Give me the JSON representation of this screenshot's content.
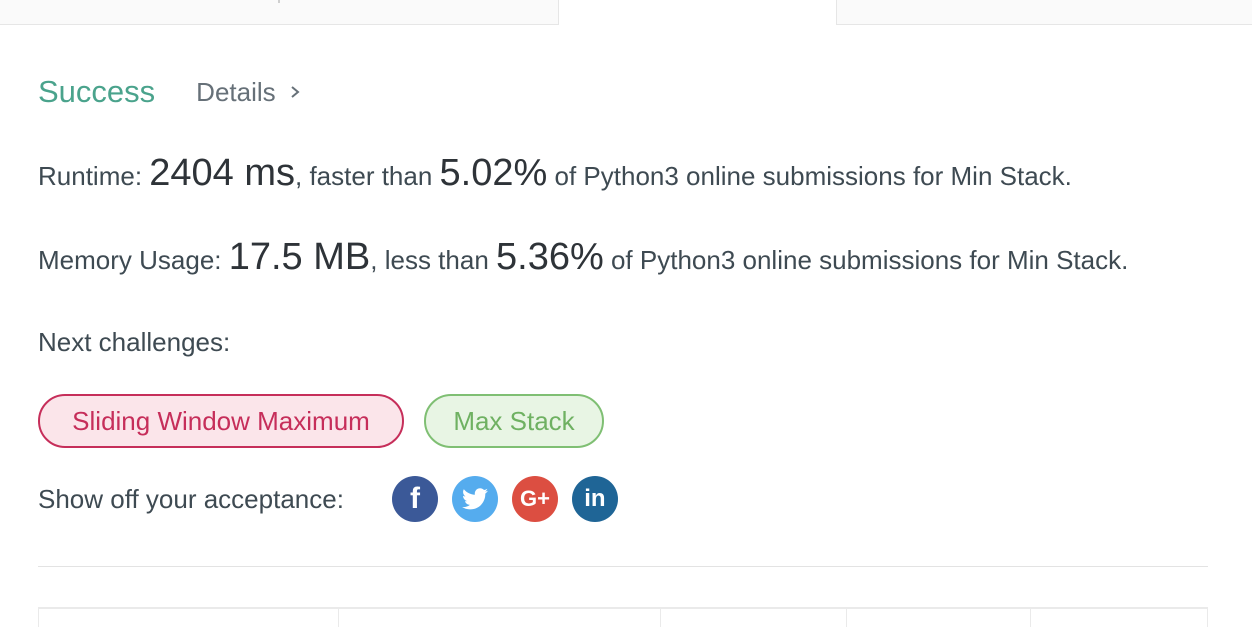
{
  "result": {
    "status": "Success",
    "details_link": "Details",
    "status_color": "#4aa38c"
  },
  "runtime": {
    "label": "Runtime: ",
    "value": "2404 ms",
    "comparison": ", faster than ",
    "percent": "5.02%",
    "suffix": " of Python3 online submissions for Min Stack."
  },
  "memory": {
    "label": "Memory Usage: ",
    "value": "17.5 MB",
    "comparison": ", less than ",
    "percent": "5.36%",
    "suffix": " of Python3 online submissions for Min Stack."
  },
  "next_challenges": {
    "label": "Next challenges:",
    "items": [
      {
        "label": "Sliding Window Maximum",
        "difficulty_color": "#c62e5a"
      },
      {
        "label": "Max Stack",
        "difficulty_color": "#6fb162"
      }
    ]
  },
  "share": {
    "label": "Show off your acceptance:",
    "icons": [
      {
        "name": "facebook-icon",
        "glyph": "f",
        "color": "#3b5998"
      },
      {
        "name": "twitter-icon",
        "glyph": "",
        "color": "#55acee"
      },
      {
        "name": "google-plus-icon",
        "glyph": "G+",
        "color": "#dc4e41"
      },
      {
        "name": "linkedin-icon",
        "glyph": "in",
        "color": "#1f6596"
      }
    ]
  }
}
